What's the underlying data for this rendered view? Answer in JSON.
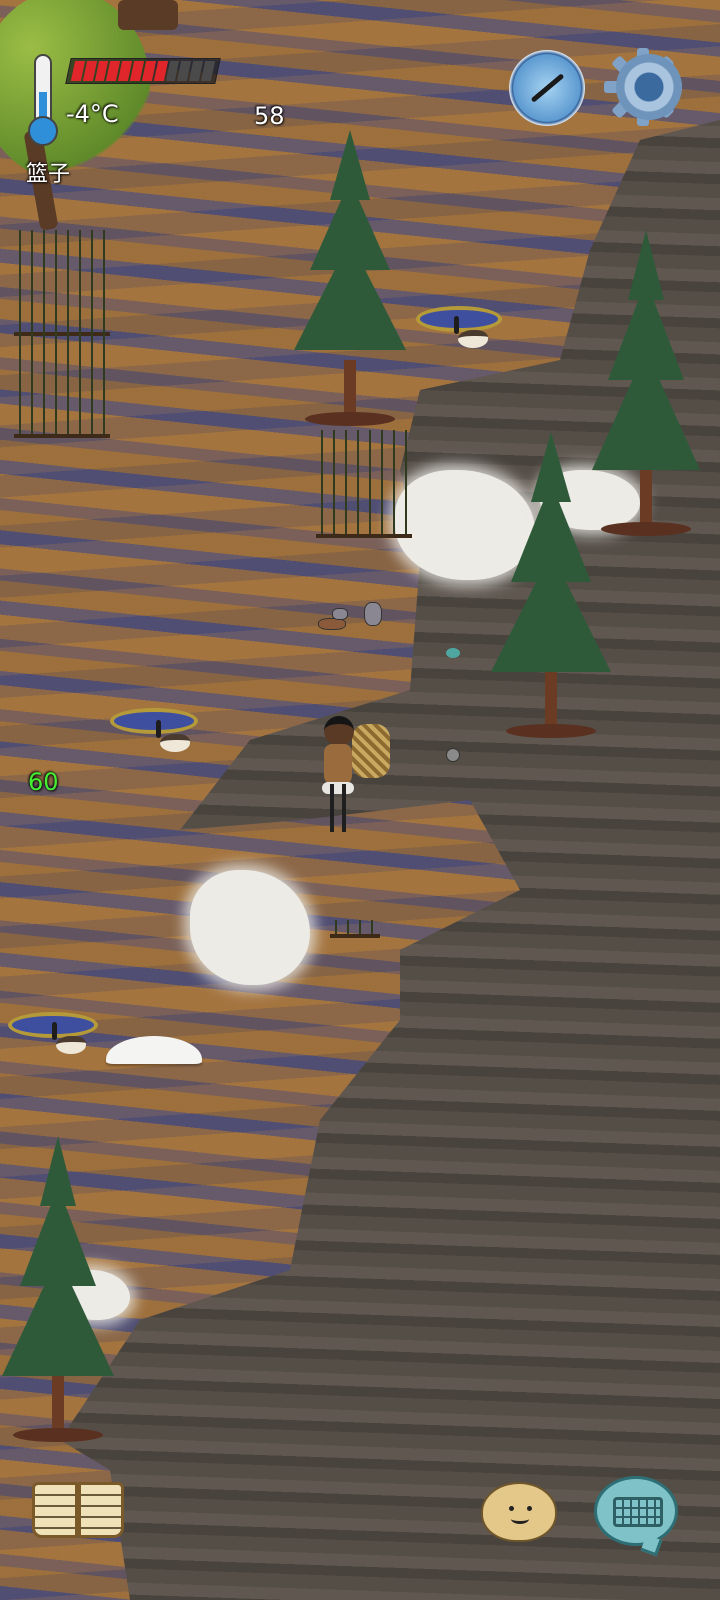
{
  "hud": {
    "temperature": "-4°C",
    "hunger_count": "58",
    "held_item": "篮子",
    "age": "60",
    "health": {
      "filled_segments": 8,
      "total_segments": 12
    }
  },
  "colors": {
    "health_fill": "#e0262a",
    "age_text": "#44ee33",
    "temperature_fill": "#2f8fd8"
  },
  "icons": {
    "thermometer": "thermometer-icon",
    "compass": "compass-icon",
    "settings": "gear-icon",
    "recipe_book": "book-icon",
    "emote": "smiley-face-icon",
    "chat": "keyboard-speech-bubble-icon"
  }
}
